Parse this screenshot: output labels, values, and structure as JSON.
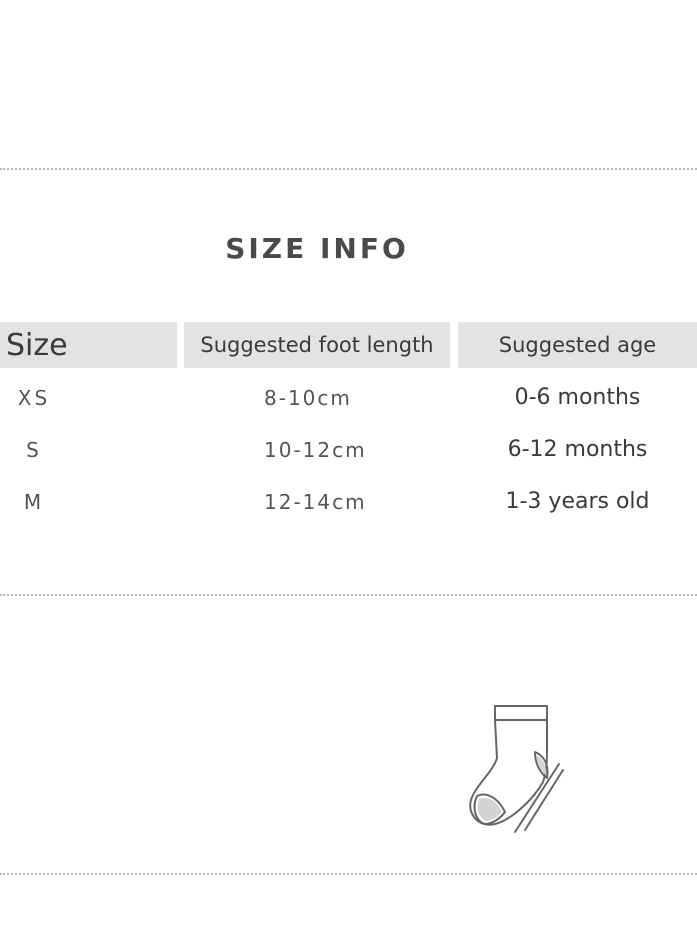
{
  "title": "SIZE INFO",
  "table": {
    "headers": {
      "size": "Size",
      "foot_length": "Suggested foot length",
      "age": "Suggested age"
    },
    "rows": [
      {
        "size": "XS",
        "foot_length": "8-10cm",
        "age": "0-6 months"
      },
      {
        "size": "S",
        "foot_length": "10-12cm",
        "age": "6-12 months"
      },
      {
        "size": "M",
        "foot_length": "12-14cm",
        "age": "1-3 years old"
      }
    ]
  },
  "icons": {
    "sock": "sock-icon"
  },
  "colors": {
    "header_background": "#e4e2e2",
    "text": "#444444",
    "divider": "#b8b8b8"
  }
}
